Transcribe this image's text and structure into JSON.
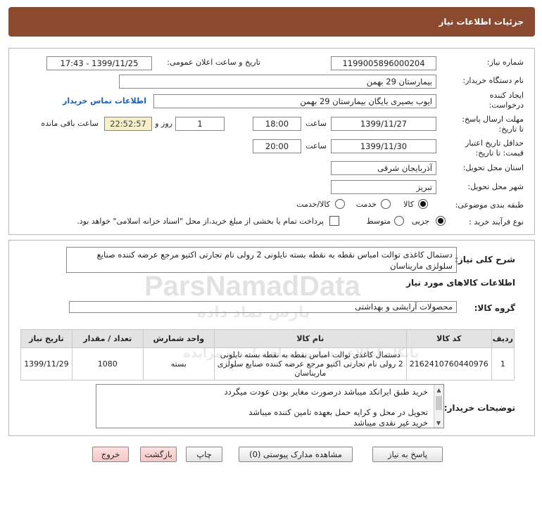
{
  "header": {
    "title": "جزئیات اطلاعات نیاز"
  },
  "form": {
    "need_number": {
      "label": "شماره نیاز:",
      "value": "1199005896000204"
    },
    "announce": {
      "label": "تاریخ و ساعت اعلان عمومی:",
      "value": "1399/11/25 - 17:43"
    },
    "buyer_org": {
      "label": "نام دستگاه خریدار:",
      "value": "بیمارستان 29 بهمن"
    },
    "requester": {
      "label_line1": "ایجاد کننده",
      "label_line2": "درخواست:",
      "value": "ایوب بصیری  بایگان بیمارستان 29 بهمن",
      "contact_link": "اطلاعات تماس خریدار"
    },
    "deadline": {
      "label_line1": "مهلت ارسال پاسخ:",
      "label_line2": "تا تاریخ:",
      "date": "1399/11/27",
      "time_label": "ساعت",
      "time": "18:00",
      "days": "1",
      "days_label": "روز و",
      "remaining": "22:52:57",
      "remaining_label": "ساعت باقی مانده"
    },
    "validity": {
      "label_line1": "حداقل تاریخ اعتبار",
      "label_line2": "قیمت: تا تاریخ:",
      "date": "1399/11/30",
      "time_label": "ساعت",
      "time": "20:00"
    },
    "province": {
      "label": "استان محل تحویل:",
      "value": "آذربایجان شرقی"
    },
    "city": {
      "label": "شهر محل تحویل:",
      "value": "تبریز"
    },
    "category": {
      "label": "طبقه بندی موضوعی:",
      "options": [
        "کالا",
        "خدمت",
        "کالا/خدمت"
      ],
      "selected": "کالا"
    },
    "process": {
      "label": "نوع فرآیند خرید :",
      "options": [
        "جزیی",
        "متوسط"
      ],
      "selected": "جزیی",
      "payment_note": "پرداخت تمام یا بخشی از مبلغ خرید،از محل \"اسناد خزانه اسلامی\" خواهد بود."
    }
  },
  "summary": {
    "label": "شرح کلی نیاز:",
    "text": "دستمال کاغذی توالت امباس نقطه به نقطه بسته نایلونی 2 رولی نام تجارتی اکتیو مرجع عرضه کننده صنایع سلولزی ماریناسان"
  },
  "goods_info_title": "اطلاعات کالاهای مورد نیاز",
  "goods_group": {
    "label": "گروه کالا:",
    "value": "محصولات آرایشی و بهداشتی"
  },
  "table": {
    "headers": [
      "ردیف",
      "کد کالا",
      "نام کالا",
      "واحد شمارش",
      "تعداد / مقدار",
      "تاریخ نیاز"
    ],
    "rows": [
      {
        "row": "1",
        "code": "2162410760440976",
        "name": "دستمال کاغذی توالت امباس نقطه به نقطه بسته نایلونی 2 رولی نام تجارتی اکتیو مرجع عرضه کننده صنایع سلولزی ماریناسان",
        "unit": "بسته",
        "qty": "1080",
        "date": "1399/11/29"
      }
    ]
  },
  "buyer_notes": {
    "label": "توضیحات خریدار:",
    "line1": "خرید طبق ایرانکد میباشد درصورت مغایر بودن عودت میگردد",
    "line2": "تحویل در محل و کرایه حمل بعهده تامین کننده میباشد",
    "line3": "خرید غیر نقدی میباشد"
  },
  "watermark": {
    "brand": "ParsNamadData",
    "brand_fa": "پارس نماد داده",
    "tagline": "پایگاه اطلاع رسانی مناقصات و مزایده"
  },
  "buttons": {
    "respond": "پاسخ به نیاز",
    "attachments": "مشاهده مدارک پیوستی (0)",
    "print": "چاپ",
    "back": "بازگشت",
    "exit": "خروج"
  },
  "colors": {
    "header": "#8b4a2f",
    "remaining_bg": "#f5f0c8",
    "link": "#1a5fb4"
  }
}
